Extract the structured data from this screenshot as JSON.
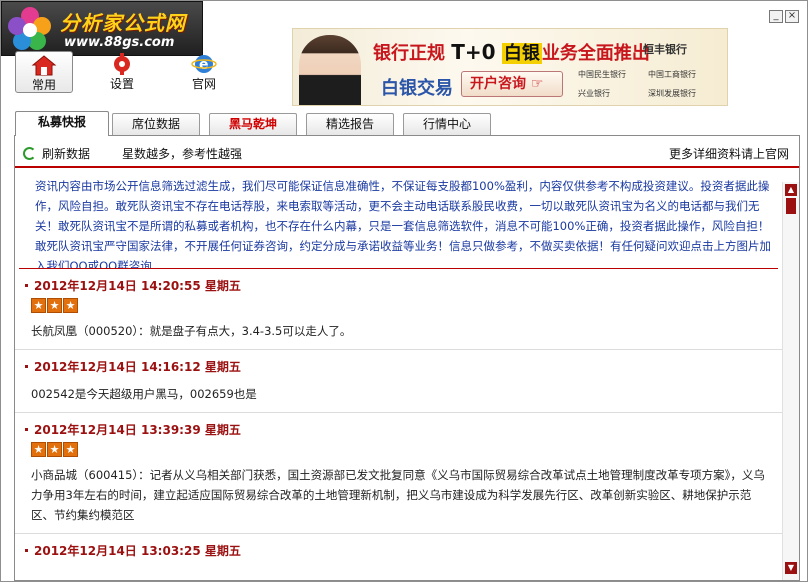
{
  "window": {
    "controls": [
      "_",
      "×"
    ]
  },
  "logo": {
    "brand": "分析家公式网",
    "site": "www.88gs.com"
  },
  "toolbar": {
    "common_label": "常用",
    "settings_label": "设置",
    "official_label": "官网"
  },
  "ad": {
    "headline_a": "银行正规",
    "headline_tp": "T+0",
    "headline_silver": "白银",
    "headline_b": "业务全面推出",
    "bank_top": "恒丰银行",
    "subline": "白银交易",
    "cta": "开户咨询",
    "banks": [
      "中国民生银行",
      "中国工商银行",
      "兴业银行",
      "深圳发展银行"
    ]
  },
  "tabs": [
    {
      "label": "私募快报",
      "active": true,
      "red": false
    },
    {
      "label": "席位数据",
      "active": false,
      "red": false
    },
    {
      "label": "黑马乾坤",
      "active": false,
      "red": true
    },
    {
      "label": "精选报告",
      "active": false,
      "red": false
    },
    {
      "label": "行情中心",
      "active": false,
      "red": false
    }
  ],
  "subbar": {
    "refresh_label": "刷新数据",
    "hint": "星数越多，参考性越强",
    "more": "更多详细资料请上官网"
  },
  "disclaimer": "资讯内容由市场公开信息筛选过滤生成，我们尽可能保证信息准确性，不保证每支股都100%盈利，内容仅供参考不构成投资建议。投资者据此操作，风险自担。敢死队资讯宝不存在电话荐股，来电索取等活动，更不会主动电话联系股民收费，一切以敢死队资讯宝为名义的电话都与我们无关！敢死队资讯宝不是所谓的私募或者机构，也不存在什么内幕，只是一套信息筛选软件，消息不可能100%正确，投资者据此操作，风险自担！敢死队资讯宝严守国家法律，不开展任何证券咨询，约定分成与承诺收益等业务！信息只做参考，不做买卖依据！有任何疑问欢迎点击上方图片加入我们QQ或QQ群咨询",
  "entries": [
    {
      "time": "2012年12月14日  14:20:55  星期五",
      "stars": 3,
      "text": "长航凤凰（000520）：就是盘子有点大，3.4-3.5可以走人了。"
    },
    {
      "time": "2012年12月14日  14:16:12  星期五",
      "stars": 0,
      "text": "002542是今天超级用户黑马，002659也是"
    },
    {
      "time": "2012年12月14日  13:39:39  星期五",
      "stars": 3,
      "text": "小商品城（600415）：记者从义乌相关部门获悉，国土资源部已发文批复同意《义乌市国际贸易综合改革试点土地管理制度改革专项方案》，义乌力争用3年左右的时间，建立起适应国际贸易综合改革的土地管理新机制，把义乌市建设成为科学发展先行区、改革创新实验区、耕地保护示范区、节约集约模范区"
    },
    {
      "time": "2012年12月14日  13:03:25  星期五",
      "stars": 0,
      "text": ""
    }
  ],
  "colors": {
    "accent_red": "#9b1010",
    "star_orange": "#e2710d",
    "disclaimer_blue": "#1a39a0"
  }
}
